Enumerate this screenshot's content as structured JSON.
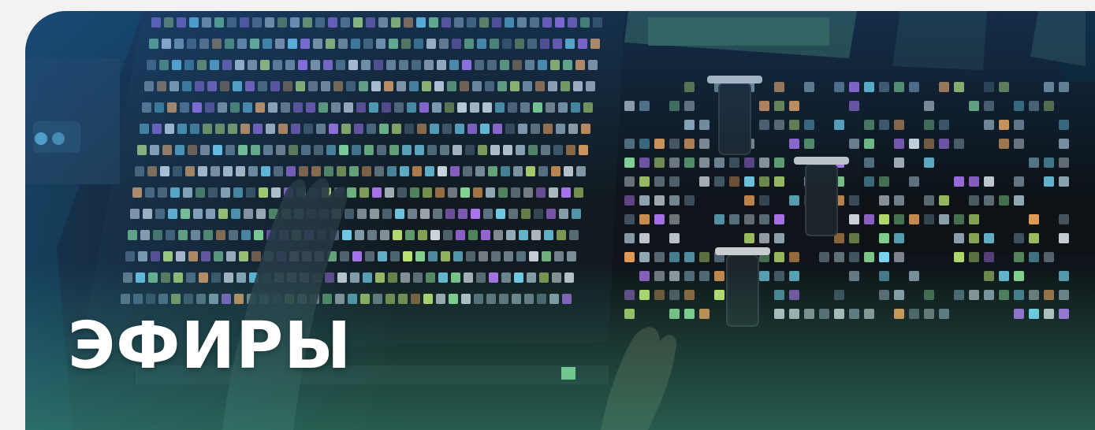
{
  "banner": {
    "title": "ЭФИРЫ",
    "image": {
      "description_icon": "broadcast-console-photo",
      "accent_colors": [
        "#7ee3ff",
        "#c9f277",
        "#8fe39a",
        "#f2a65a",
        "#b97cff"
      ]
    }
  }
}
